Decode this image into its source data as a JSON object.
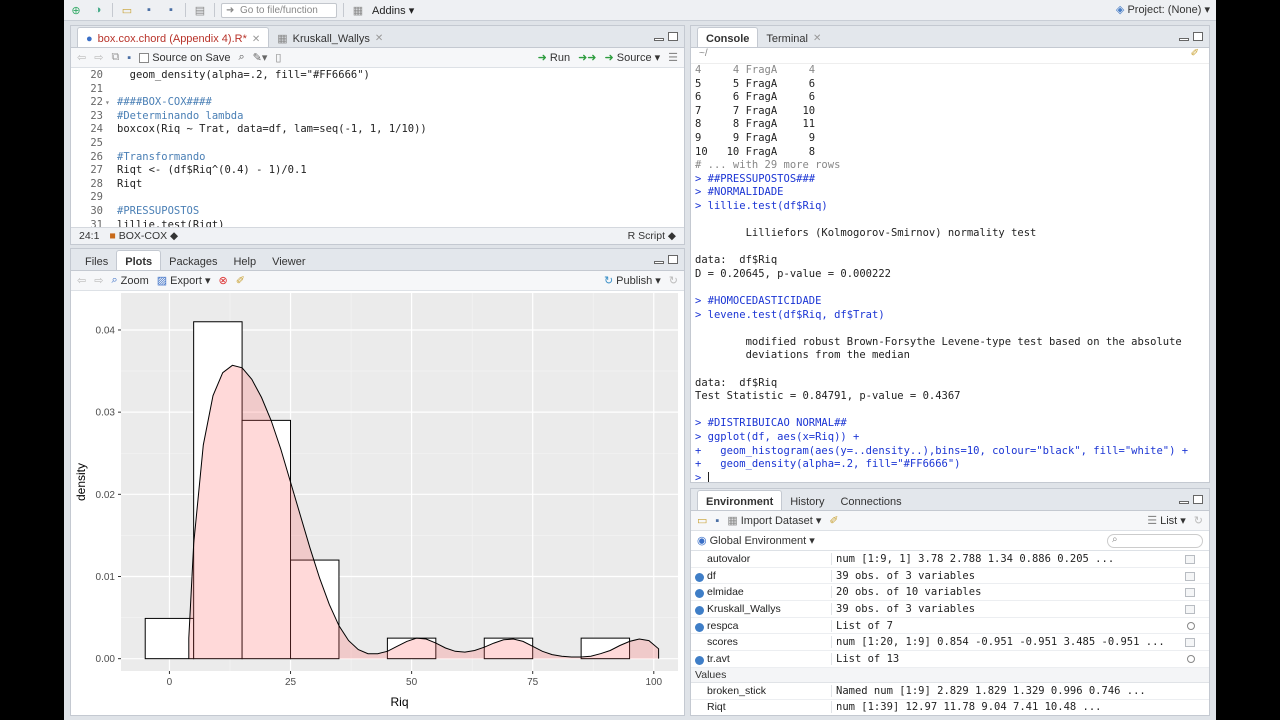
{
  "toolbar": {
    "goto_placeholder": "Go to file/function",
    "addins_label": "Addins",
    "project_label": "Project: (None)"
  },
  "editor": {
    "tabs": [
      {
        "label": "box.cox.chord (Appendix 4).R*",
        "active": true
      },
      {
        "label": "Kruskall_Wallys",
        "active": false
      }
    ],
    "source_on_save_label": "Source on Save",
    "run_label": "Run",
    "source_label": "Source",
    "lines": [
      {
        "n": "20",
        "text": "  geom_density(alpha=.2, fill=\"#FF6666\")",
        "kind": "code",
        "fold": ""
      },
      {
        "n": "21",
        "text": "",
        "kind": "code",
        "fold": ""
      },
      {
        "n": "22",
        "text": "####BOX-COX####",
        "kind": "comment",
        "fold": "▾"
      },
      {
        "n": "23",
        "text": "#Determinando lambda",
        "kind": "comment",
        "fold": ""
      },
      {
        "n": "24",
        "text": "boxcox(Riq ~ Trat, data=df, lam=seq(-1, 1, 1/10))",
        "kind": "code",
        "fold": ""
      },
      {
        "n": "25",
        "text": "",
        "kind": "code",
        "fold": ""
      },
      {
        "n": "26",
        "text": "#Transformando",
        "kind": "comment",
        "fold": ""
      },
      {
        "n": "27",
        "text": "Riqt <- (df$Riq^(0.4) - 1)/0.1",
        "kind": "code",
        "fold": ""
      },
      {
        "n": "28",
        "text": "Riqt",
        "kind": "code",
        "fold": ""
      },
      {
        "n": "29",
        "text": "",
        "kind": "code",
        "fold": ""
      },
      {
        "n": "30",
        "text": "#PRESSUPOSTOS",
        "kind": "comment",
        "fold": ""
      },
      {
        "n": "31",
        "text": "lillie.test(Riqt)",
        "kind": "code",
        "fold": ""
      }
    ],
    "status_position": "24:1",
    "status_section": "BOX-COX",
    "status_filetype": "R Script"
  },
  "plots": {
    "tabs": [
      "Files",
      "Plots",
      "Packages",
      "Help",
      "Viewer"
    ],
    "active_tab": "Plots",
    "zoom_label": "Zoom",
    "export_label": "Export",
    "publish_label": "Publish"
  },
  "chart_data": {
    "type": "bar",
    "title": "",
    "xlabel": "Riq",
    "ylabel": "density",
    "xlim": [
      -10,
      105
    ],
    "ylim": [
      -0.0015,
      0.0445
    ],
    "x_ticks": [
      0,
      25,
      50,
      75,
      100
    ],
    "y_ticks": [
      0.0,
      0.01,
      0.02,
      0.03,
      0.04
    ],
    "y_tick_labels": [
      "0.00",
      "0.01",
      "0.02",
      "0.03",
      "0.04"
    ],
    "x_tick_labels": [
      "0",
      "25",
      "50",
      "75",
      "100"
    ],
    "histogram": {
      "bin_edges": [
        -5,
        5,
        15,
        25,
        35,
        45,
        55,
        65,
        75,
        85,
        95,
        105
      ],
      "values": [
        0.0049,
        0.041,
        0.029,
        0.012,
        0.0,
        0.0025,
        0.0,
        0.0025,
        0.0,
        0.0025,
        0.0
      ]
    },
    "density": {
      "x": [
        4,
        5,
        7,
        9,
        11,
        13,
        15,
        17,
        19,
        21,
        23,
        25,
        27,
        29,
        31,
        33,
        35,
        37,
        39,
        41,
        43,
        45,
        47,
        49,
        51,
        53,
        55,
        57,
        59,
        61,
        63,
        65,
        67,
        69,
        71,
        73,
        75,
        77,
        79,
        81,
        83,
        85,
        87,
        89,
        91,
        93,
        95,
        97,
        99,
        101
      ],
      "y": [
        0.0025,
        0.014,
        0.026,
        0.032,
        0.0348,
        0.0357,
        0.0354,
        0.034,
        0.0318,
        0.029,
        0.0255,
        0.0215,
        0.0175,
        0.0135,
        0.0098,
        0.0066,
        0.004,
        0.0022,
        0.0011,
        0.0006,
        0.0006,
        0.0009,
        0.0015,
        0.0021,
        0.0025,
        0.0024,
        0.0019,
        0.0013,
        0.0009,
        0.0008,
        0.001,
        0.0014,
        0.0019,
        0.0023,
        0.0024,
        0.0021,
        0.0015,
        0.0009,
        0.0005,
        0.0003,
        0.0002,
        0.0002,
        0.0003,
        0.0006,
        0.001,
        0.0016,
        0.0021,
        0.0024,
        0.0022,
        0.0012
      ]
    },
    "colors": {
      "bar_fill": "#ffffff",
      "bar_outline": "#000000",
      "density_fill": "#FF6666",
      "panel_bg": "#ebebeb"
    }
  },
  "console": {
    "tabs": [
      "Console",
      "Terminal"
    ],
    "path": "~/",
    "lines": [
      {
        "text": "4     4 FragA     4",
        "kind": "dim"
      },
      {
        "text": "5     5 FragA     6",
        "kind": "out"
      },
      {
        "text": "6     6 FragA     6",
        "kind": "out"
      },
      {
        "text": "7     7 FragA    10",
        "kind": "out"
      },
      {
        "text": "8     8 FragA    11",
        "kind": "out"
      },
      {
        "text": "9     9 FragA     9",
        "kind": "out"
      },
      {
        "text": "10   10 FragA     8",
        "kind": "out"
      },
      {
        "text": "# ... with 29 more rows",
        "kind": "dim"
      },
      {
        "text": "> ##PRESSUPOSTOS###",
        "kind": "input"
      },
      {
        "text": "> #NORMALIDADE",
        "kind": "input"
      },
      {
        "text": "> lillie.test(df$Riq)",
        "kind": "input"
      },
      {
        "text": "",
        "kind": "out"
      },
      {
        "text": "        Lilliefors (Kolmogorov-Smirnov) normality test",
        "kind": "out"
      },
      {
        "text": "",
        "kind": "out"
      },
      {
        "text": "data:  df$Riq",
        "kind": "out"
      },
      {
        "text": "D = 0.20645, p-value = 0.000222",
        "kind": "out"
      },
      {
        "text": "",
        "kind": "out"
      },
      {
        "text": "> #HOMOCEDASTICIDADE",
        "kind": "input"
      },
      {
        "text": "> levene.test(df$Riq, df$Trat)",
        "kind": "input"
      },
      {
        "text": "",
        "kind": "out"
      },
      {
        "text": "        modified robust Brown-Forsythe Levene-type test based on the absolute",
        "kind": "out"
      },
      {
        "text": "        deviations from the median",
        "kind": "out"
      },
      {
        "text": "",
        "kind": "out"
      },
      {
        "text": "data:  df$Riq",
        "kind": "out"
      },
      {
        "text": "Test Statistic = 0.84791, p-value = 0.4367",
        "kind": "out"
      },
      {
        "text": "",
        "kind": "out"
      },
      {
        "text": "> #DISTRIBUICAO NORMAL##",
        "kind": "input"
      },
      {
        "text": "> ggplot(df, aes(x=Riq)) +",
        "kind": "input"
      },
      {
        "text": "+   geom_histogram(aes(y=..density..),bins=10, colour=\"black\", fill=\"white\") +",
        "kind": "input"
      },
      {
        "text": "+   geom_density(alpha=.2, fill=\"#FF6666\")",
        "kind": "input"
      }
    ],
    "prompt": ">"
  },
  "environment": {
    "tabs": [
      "Environment",
      "History",
      "Connections"
    ],
    "import_label": "Import Dataset",
    "list_label": "List",
    "scope_label": "Global Environment",
    "rows": [
      {
        "name": "autovalor",
        "value": "num [1:9, 1] 3.78 2.788 1.34 0.886 0.205 ...",
        "expand": false,
        "icon": "grid"
      },
      {
        "name": "df",
        "value": "39 obs. of 3 variables",
        "expand": true,
        "icon": "grid"
      },
      {
        "name": "elmidae",
        "value": "20 obs. of 10 variables",
        "expand": true,
        "icon": "grid"
      },
      {
        "name": "Kruskall_Wallys",
        "value": "39 obs. of 3 variables",
        "expand": true,
        "icon": "grid"
      },
      {
        "name": "respca",
        "value": "List of 7",
        "expand": true,
        "icon": "search"
      },
      {
        "name": "scores",
        "value": "num [1:20, 1:9] 0.854 -0.951 -0.951 3.485 -0.951 ...",
        "expand": false,
        "icon": "grid"
      },
      {
        "name": "tr.avt",
        "value": "List of 13",
        "expand": true,
        "icon": "search"
      }
    ],
    "values_header": "Values",
    "values_rows": [
      {
        "name": "broken_stick",
        "value": "Named num [1:9] 2.829 1.829 1.329 0.996 0.746 ..."
      },
      {
        "name": "Riqt",
        "value": "num [1:39] 12.97 11.78 9.04 7.41 10.48 ..."
      }
    ]
  }
}
